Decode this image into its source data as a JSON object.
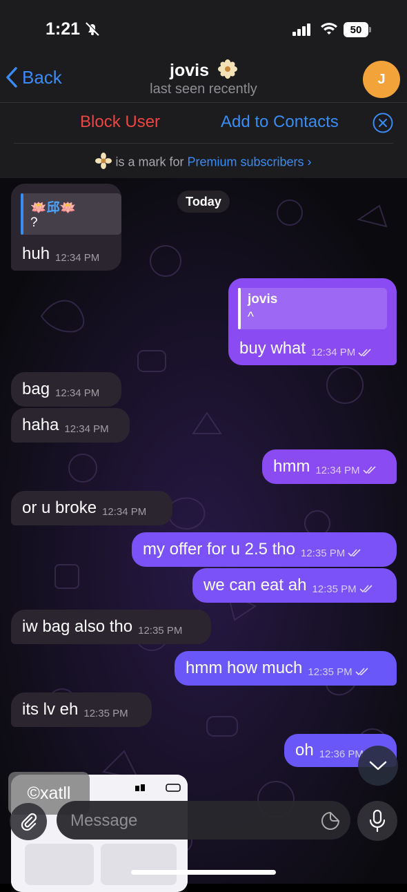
{
  "status": {
    "time": "1:21",
    "battery": "50"
  },
  "nav": {
    "back_label": "Back",
    "name": "jovis",
    "last_seen": "last seen recently",
    "avatar_initial": "J"
  },
  "actions": {
    "block": "Block User",
    "add_contacts": "Add to Contacts"
  },
  "premium": {
    "text": "is a mark for",
    "link": "Premium subscribers"
  },
  "chat": {
    "date_label": "Today",
    "messages": [
      {
        "dir": "in",
        "reply_author": "🪷邱🪷",
        "reply_text": "?",
        "text": "huh",
        "time": "12:34 PM"
      },
      {
        "dir": "out",
        "reply_author": "jovis",
        "reply_text": "^",
        "text": "buy what",
        "time": "12:34 PM"
      },
      {
        "dir": "in",
        "text": "bag",
        "time": "12:34 PM"
      },
      {
        "dir": "in",
        "text": "haha",
        "time": "12:34 PM"
      },
      {
        "dir": "out",
        "text": "hmm",
        "time": "12:34 PM"
      },
      {
        "dir": "in",
        "text": "or u broke",
        "time": "12:34 PM"
      },
      {
        "dir": "out",
        "text": "my offer for u 2.5 tho",
        "time": "12:35 PM"
      },
      {
        "dir": "out",
        "text": "we can eat ah",
        "time": "12:35 PM"
      },
      {
        "dir": "in",
        "text": "iw bag also tho",
        "time": "12:35 PM"
      },
      {
        "dir": "out",
        "text": "hmm how much",
        "time": "12:35 PM"
      },
      {
        "dir": "in",
        "text": "its lv eh",
        "time": "12:35 PM"
      },
      {
        "dir": "out",
        "text": "oh",
        "time": "12:36 PM"
      }
    ]
  },
  "composer": {
    "placeholder": "Message"
  },
  "watermark": "©xatll",
  "colors": {
    "accent": "#3a8cf5",
    "danger": "#eb4545",
    "outgoing": "#8a4cf2",
    "incoming": "#2b2530"
  }
}
